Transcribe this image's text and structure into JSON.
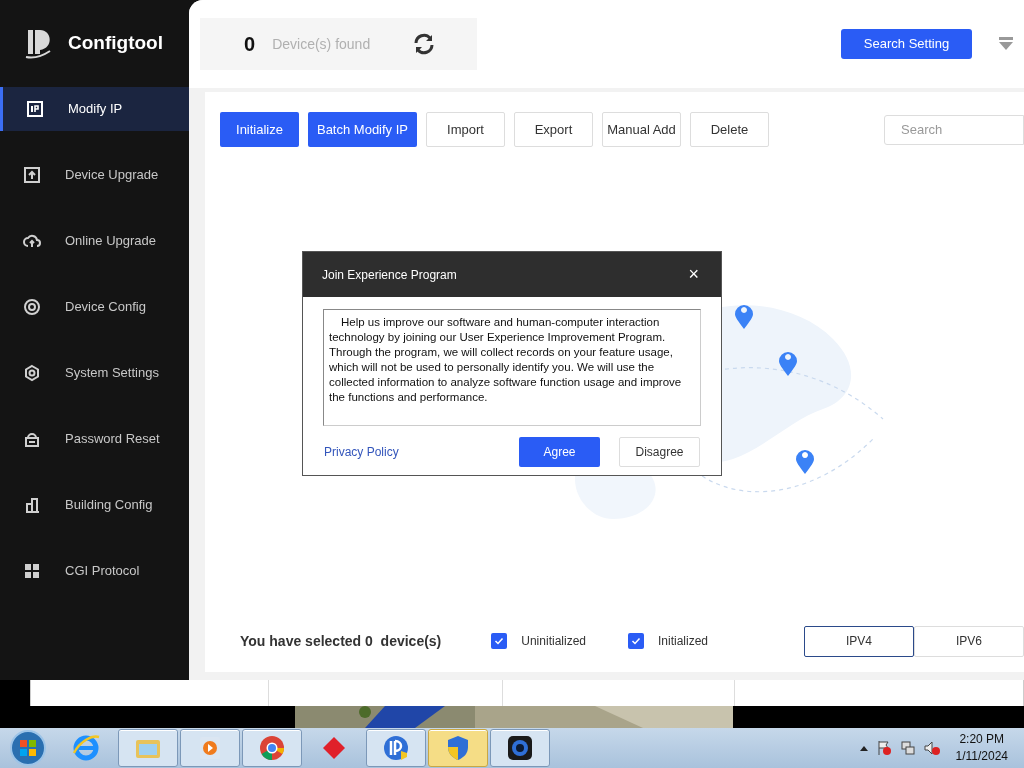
{
  "app": {
    "name": "Configtool"
  },
  "sidebar": {
    "items": [
      {
        "label": "Modify IP",
        "selected": true
      },
      {
        "label": "Device Upgrade",
        "selected": false
      },
      {
        "label": "Online Upgrade",
        "selected": false
      },
      {
        "label": "Device Config",
        "selected": false
      },
      {
        "label": "System Settings",
        "selected": false
      },
      {
        "label": "Password Reset",
        "selected": false
      },
      {
        "label": "Building Config",
        "selected": false
      },
      {
        "label": "CGI Protocol",
        "selected": false
      }
    ]
  },
  "header": {
    "count": "0",
    "count_label": "Device(s) found",
    "search_setting": "Search Setting"
  },
  "toolbar": {
    "buttons": [
      {
        "label": "Initialize",
        "kind": "primary"
      },
      {
        "label": "Batch Modify IP",
        "kind": "primary"
      },
      {
        "label": "Import",
        "kind": "default"
      },
      {
        "label": "Export",
        "kind": "default"
      },
      {
        "label": "Manual Add",
        "kind": "default"
      },
      {
        "label": "Delete",
        "kind": "default"
      }
    ],
    "search": {
      "placeholder": "Search"
    }
  },
  "dialog": {
    "title": "Join Experience Program",
    "close": "×",
    "body": "Help us improve our software and human-computer interaction technology by joining our User Experience Improvement Program. Through the program, we will collect records on your feature usage, which will not be used to personally identify you. We will use the collected information to analyze software function usage and improve the functions and performance.",
    "link": "Privacy Policy",
    "agree": "Agree",
    "disagree": "Disagree"
  },
  "footer": {
    "selected_text": "You have selected 0  device(s)",
    "filters": [
      {
        "label": "Uninitialized",
        "checked": true
      },
      {
        "label": "Initialized",
        "checked": true
      }
    ],
    "tabs": [
      {
        "label": "IPV4",
        "selected": true
      },
      {
        "label": "IPV6",
        "selected": false
      }
    ]
  },
  "taskbar": {
    "items": [
      {
        "open": false,
        "selected": false
      },
      {
        "open": true,
        "selected": false
      },
      {
        "open": true,
        "selected": false
      },
      {
        "open": true,
        "selected": false
      },
      {
        "open": false,
        "selected": false
      },
      {
        "open": true,
        "selected": false
      },
      {
        "open": true,
        "selected": true
      },
      {
        "open": true,
        "selected": false
      }
    ],
    "time": "2:20 PM",
    "date": "1/11/2024"
  }
}
